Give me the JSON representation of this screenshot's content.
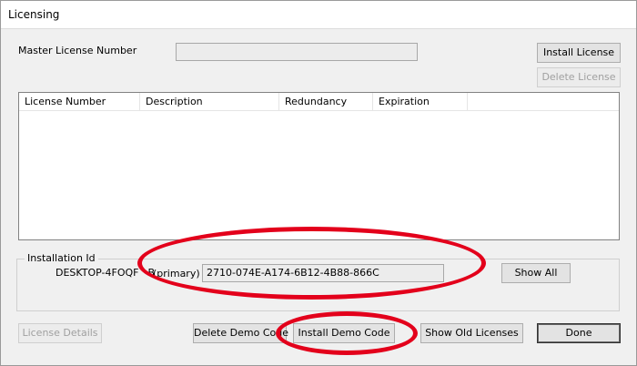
{
  "window": {
    "title": "Licensing"
  },
  "master_license": {
    "label": "Master License Number",
    "value": ""
  },
  "buttons": {
    "install_license": "Install License",
    "delete_license": "Delete License",
    "show_all": "Show All",
    "license_details": "License Details",
    "delete_demo_code": "Delete Demo Code",
    "install_demo_code": "Install Demo Code",
    "show_old_licenses": "Show Old Licenses",
    "done": "Done"
  },
  "license_table": {
    "columns": [
      "License Number",
      "Description",
      "Redundancy",
      "Expiration"
    ],
    "rows": []
  },
  "installation": {
    "group_label": "Installation Id",
    "machine_name": "DESKTOP-4FOQF",
    "machine_name_suffix": "B",
    "role": "(primary)",
    "id_value": "2710-074E-A174-6B12-4B88-866C"
  },
  "colors": {
    "highlight": "#e3001b"
  }
}
